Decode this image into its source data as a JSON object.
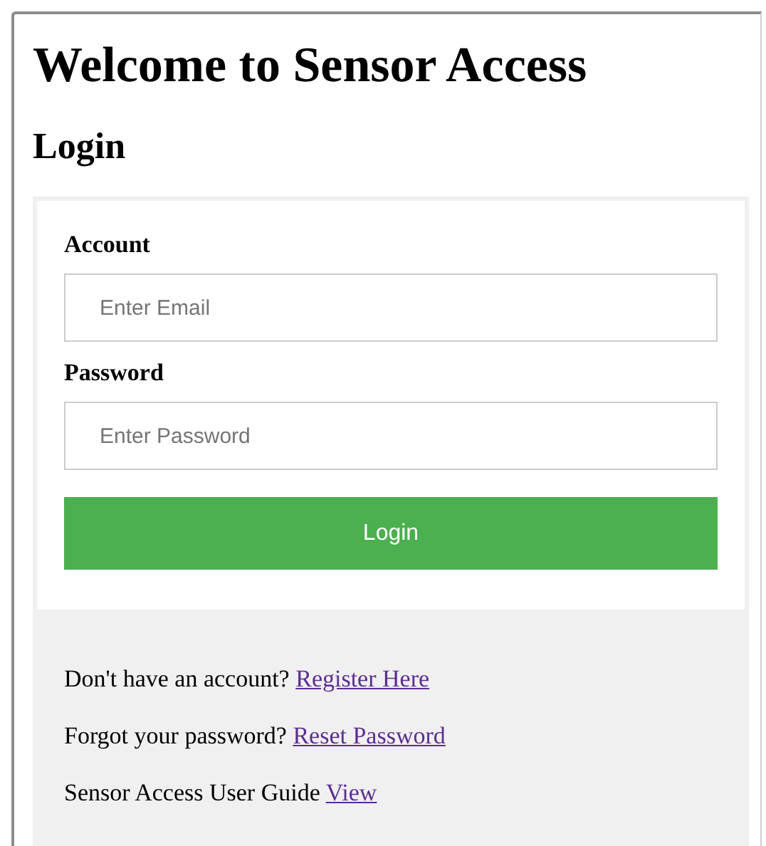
{
  "title": "Welcome to Sensor Access",
  "subtitle": "Login",
  "form": {
    "fields": [
      {
        "label": "Account",
        "placeholder": "Enter Email"
      },
      {
        "label": "Password",
        "placeholder": "Enter Password"
      }
    ],
    "button": "Login"
  },
  "links": [
    {
      "text": "Don't have an account?",
      "link": "Register Here"
    },
    {
      "text": "Forgot your password?",
      "link": "Reset Password"
    },
    {
      "text": "Sensor Access User Guide",
      "link": "View"
    }
  ]
}
